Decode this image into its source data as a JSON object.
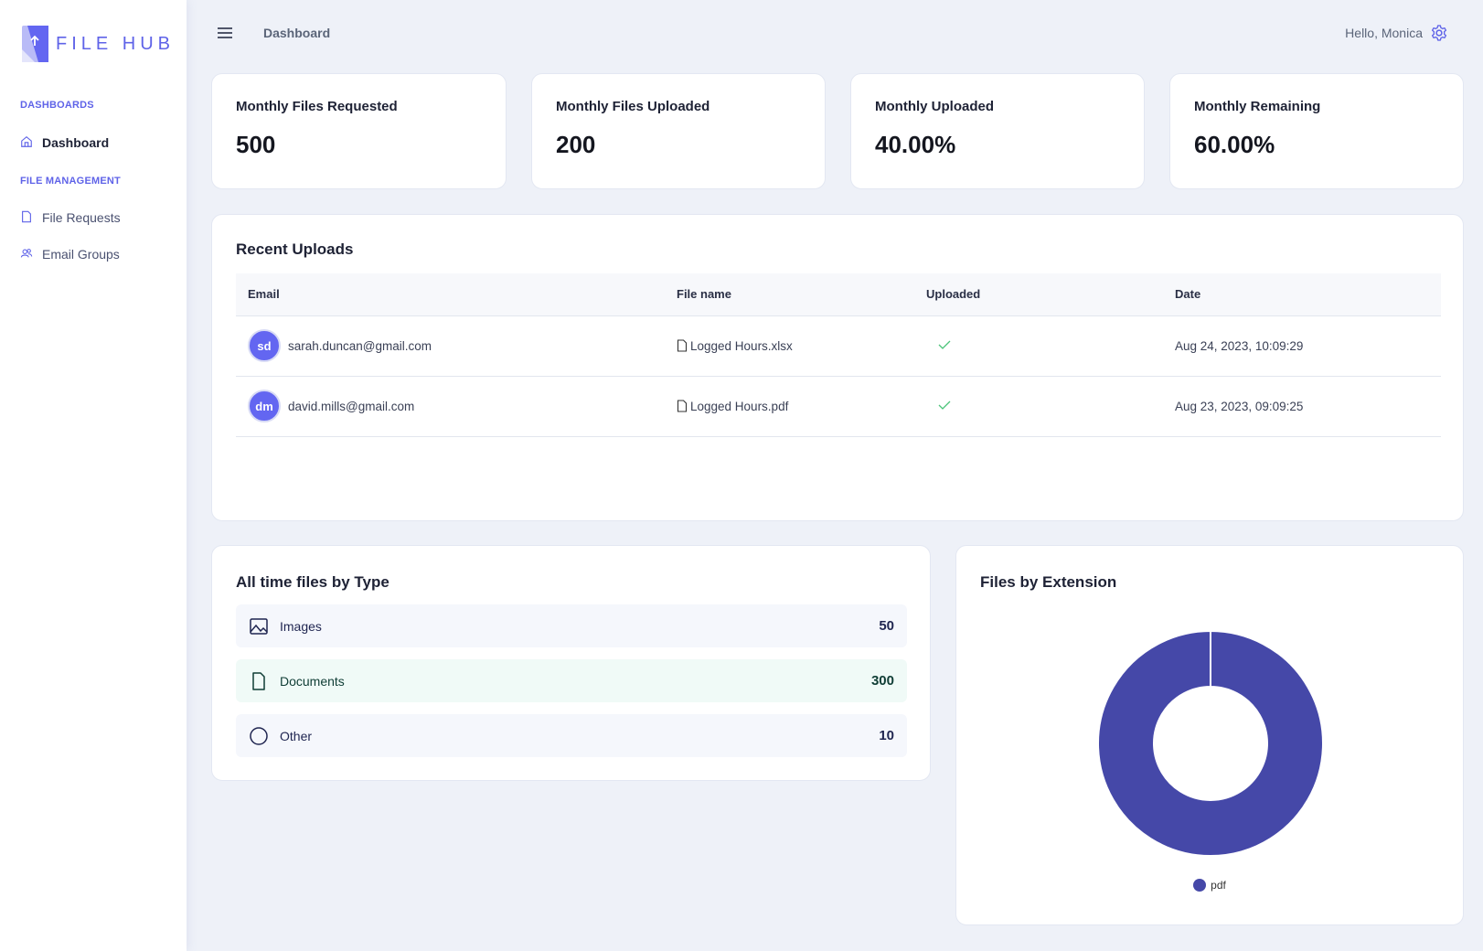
{
  "app": {
    "name": "FILE HUB",
    "brand_color": "#5f63e8"
  },
  "sidebar": {
    "sections": [
      {
        "label": "DASHBOARDS",
        "items": [
          {
            "label": "Dashboard",
            "icon": "home-icon",
            "active": true
          }
        ]
      },
      {
        "label": "FILE MANAGEMENT",
        "items": [
          {
            "label": "File Requests",
            "icon": "file-icon",
            "active": false
          },
          {
            "label": "Email Groups",
            "icon": "users-icon",
            "active": false
          }
        ]
      }
    ]
  },
  "header": {
    "breadcrumb": "Dashboard",
    "greeting": "Hello, Monica",
    "menu_icon": "hamburger-icon",
    "settings_icon": "gear-icon"
  },
  "stats": [
    {
      "title": "Monthly Files Requested",
      "value": "500"
    },
    {
      "title": "Monthly Files Uploaded",
      "value": "200"
    },
    {
      "title": "Monthly Uploaded",
      "value": "40.00%"
    },
    {
      "title": "Monthly Remaining",
      "value": "60.00%"
    }
  ],
  "recent_uploads": {
    "title": "Recent Uploads",
    "columns": [
      "Email",
      "File name",
      "Uploaded",
      "Date"
    ],
    "rows": [
      {
        "initials": "sd",
        "email": "sarah.duncan@gmail.com",
        "file": "Logged Hours.xlsx",
        "uploaded": true,
        "date": "Aug 24, 2023, 10:09:29"
      },
      {
        "initials": "dm",
        "email": "david.mills@gmail.com",
        "file": "Logged Hours.pdf",
        "uploaded": true,
        "date": "Aug 23, 2023, 09:09:25"
      }
    ]
  },
  "files_by_type": {
    "title": "All time files by Type",
    "items": [
      {
        "label": "Images",
        "count": "50",
        "icon": "image-icon",
        "bg": "#f5f7fc",
        "color": "#1f2550"
      },
      {
        "label": "Documents",
        "count": "300",
        "icon": "document-icon",
        "bg": "#f0faf7",
        "color": "#0f3d35"
      },
      {
        "label": "Other",
        "count": "10",
        "icon": "circle-icon",
        "bg": "#f5f7fc",
        "color": "#1f2550"
      }
    ]
  },
  "chart_data": {
    "type": "pie",
    "title": "Files by Extension",
    "donut": true,
    "categories": [
      "pdf"
    ],
    "values": [
      100
    ],
    "colors": [
      "#4548a8"
    ],
    "legend": "bottom"
  }
}
